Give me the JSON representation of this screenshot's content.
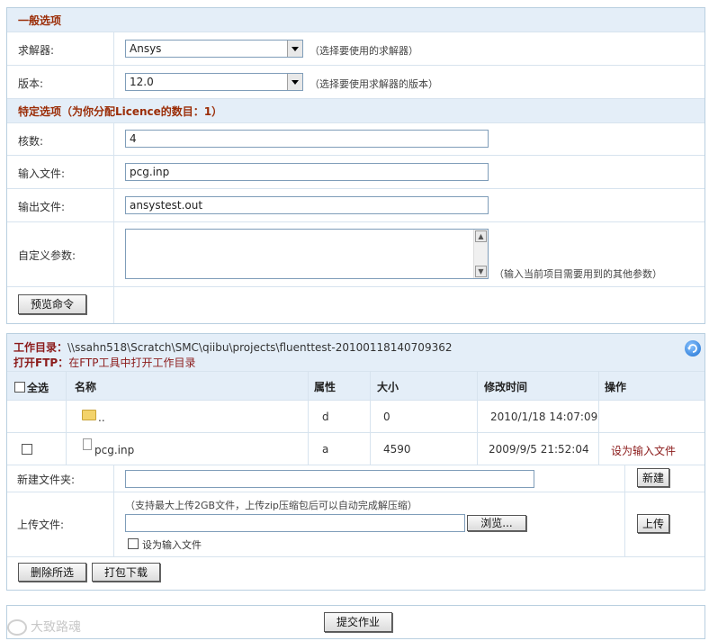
{
  "general": {
    "heading": "一般选项",
    "solver_label": "求解器:",
    "solver_value": "Ansys",
    "solver_hint": "（选择要使用的求解器）",
    "version_label": "版本:",
    "version_value": "12.0",
    "version_hint": "（选择要使用求解器的版本）"
  },
  "specific": {
    "heading": "特定选项（为你分配Licence的数目：1）",
    "cores_label": "核数:",
    "cores_value": "4",
    "input_label": "输入文件:",
    "input_value": "pcg.inp",
    "output_label": "输出文件:",
    "output_value": "ansystest.out",
    "custom_label": "自定义参数:",
    "custom_hint": "（输入当前项目需要用到的其他参数）",
    "preview_button": "预览命令"
  },
  "workdir": {
    "dir_label": "工作目录：",
    "dir_path": "\\\\ssahn518\\Scratch\\SMC\\qiibu\\projects\\fluenttest-20100118140709362",
    "ftp_label": "打开FTP：",
    "ftp_link": "在FTP工具中打开工作目录"
  },
  "table": {
    "select_all": "全选",
    "headers": [
      "名称",
      "属性",
      "大小",
      "修改时间",
      "操作"
    ],
    "rows": [
      {
        "name": "..",
        "attr": "d",
        "size": "0",
        "mtime": "2010/1/18 14:07:09",
        "action": ""
      },
      {
        "name": "pcg.inp",
        "attr": "a",
        "size": "4590",
        "mtime": "2009/9/5 21:52:04",
        "action": "设为输入文件"
      }
    ]
  },
  "new_folder": {
    "label": "新建文件夹:",
    "button": "新建"
  },
  "upload": {
    "label": "上传文件:",
    "hint": "（支持最大上传2GB文件，上传zip压缩包后可以自动完成解压缩）",
    "browse": "浏览...",
    "set_input": "设为输入文件",
    "button": "上传"
  },
  "actions": {
    "delete_selected": "删除所选",
    "pack_download": "打包下载"
  },
  "submit": "提交作业",
  "watermark": "大致路魂",
  "colors": {
    "accent": "#9b2d07",
    "header_bg": "#e4eef8",
    "border": "#b9cfe0"
  }
}
